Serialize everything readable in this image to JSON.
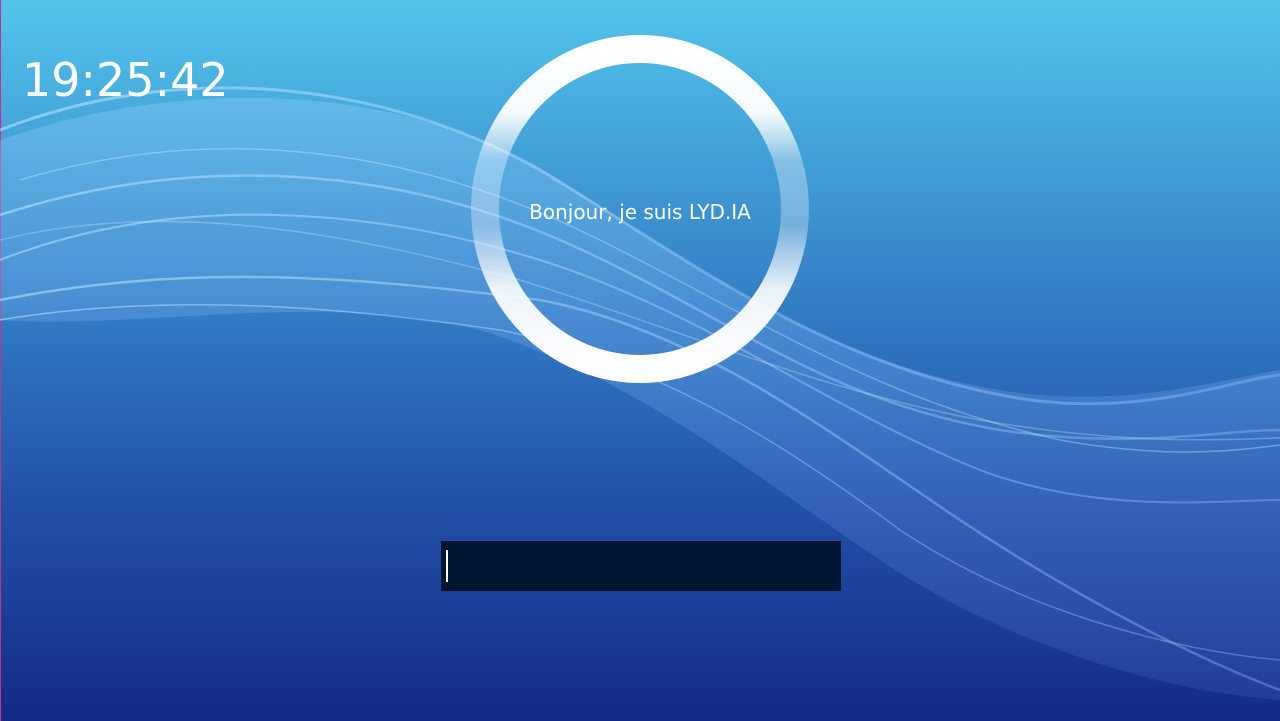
{
  "clock": {
    "time": "19:25:42"
  },
  "assistant": {
    "greeting": "Bonjour, je suis LYD.IA",
    "ring_icon": "assistant-ring-icon"
  },
  "input": {
    "value": "",
    "placeholder": ""
  },
  "theme": {
    "accent": "#ffffff",
    "input_background": "#021533",
    "background_top": "#52c4ec",
    "background_bottom": "#142a84"
  }
}
